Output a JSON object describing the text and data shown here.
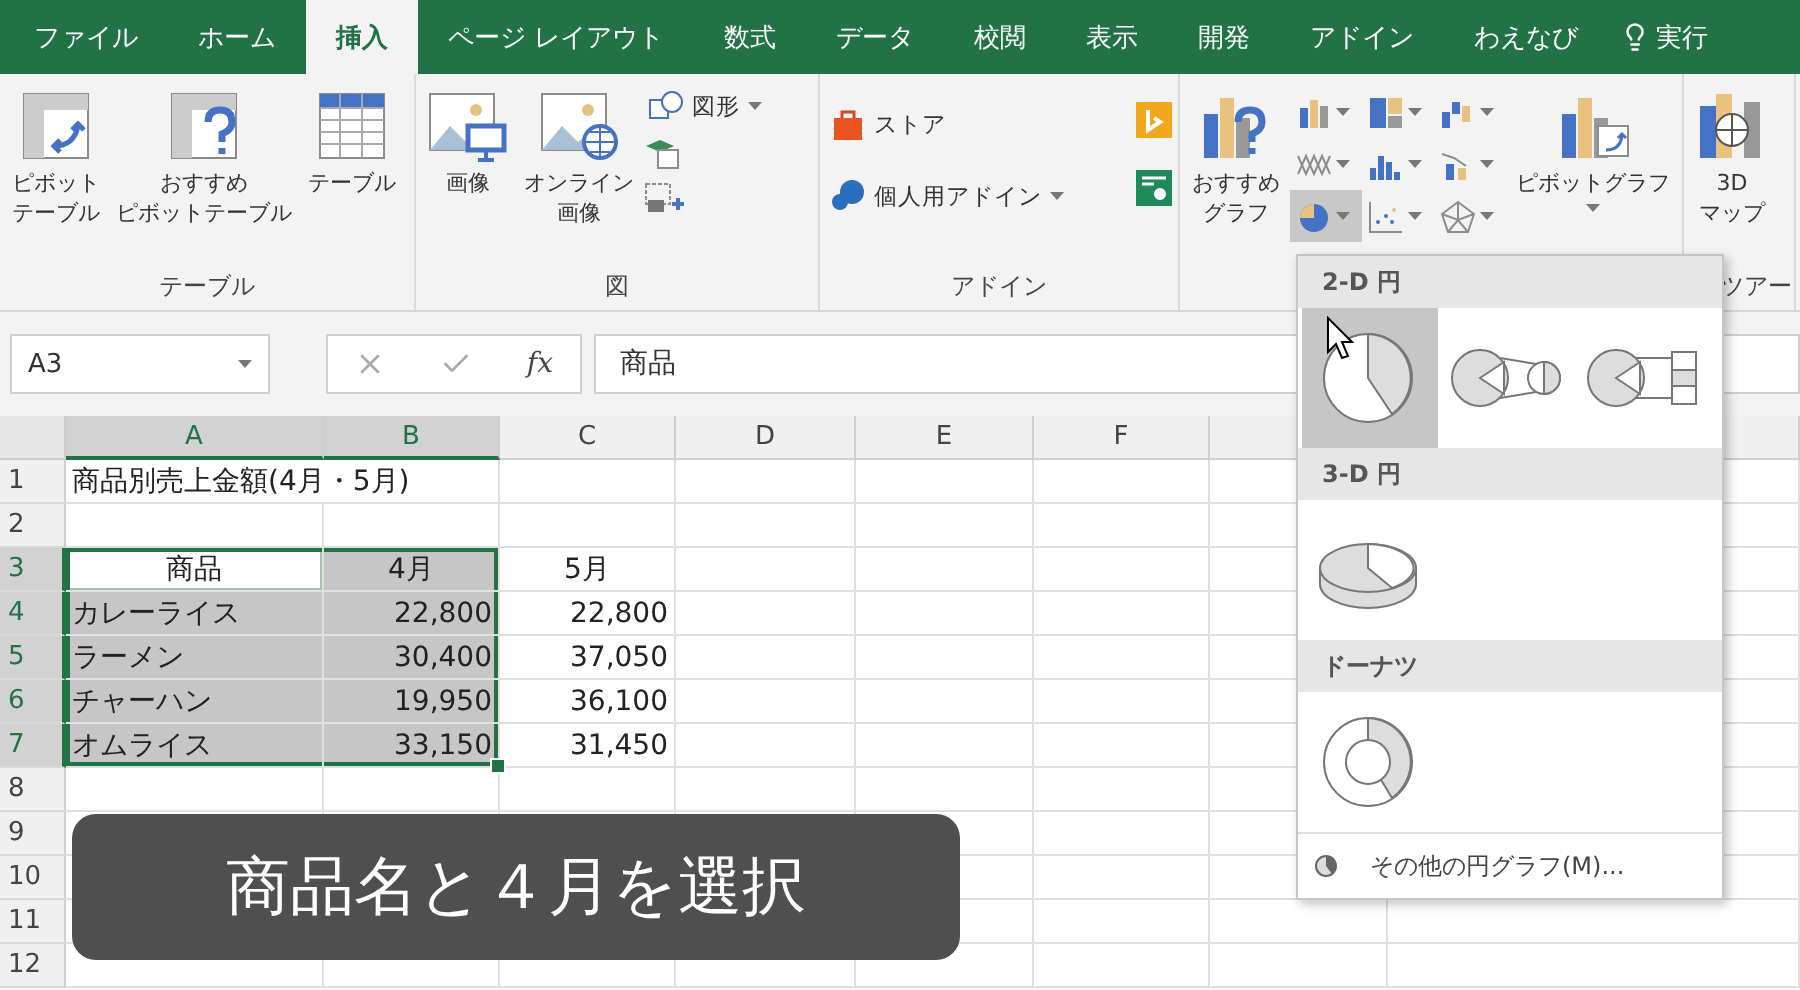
{
  "tabs": [
    {
      "label": "ファイル",
      "selected": false
    },
    {
      "label": "ホーム",
      "selected": false
    },
    {
      "label": "挿入",
      "selected": true
    },
    {
      "label": "ページ レイアウト",
      "selected": false
    },
    {
      "label": "数式",
      "selected": false
    },
    {
      "label": "データ",
      "selected": false
    },
    {
      "label": "校閲",
      "selected": false
    },
    {
      "label": "表示",
      "selected": false
    },
    {
      "label": "開発",
      "selected": false
    },
    {
      "label": "アドイン",
      "selected": false
    },
    {
      "label": "わえなび",
      "selected": false
    }
  ],
  "tell_me": "実行",
  "ribbon": {
    "table_group": {
      "label": "テーブル",
      "buttons": [
        [
          "ピボット",
          "テーブル"
        ],
        [
          "おすすめ",
          "ピボットテーブル"
        ],
        [
          "テーブル"
        ]
      ]
    },
    "illustrations_group": {
      "label": "図",
      "buttons": [
        [
          "画像"
        ],
        [
          "オンライン",
          "画像"
        ]
      ],
      "shapes": "図形"
    },
    "addins_group": {
      "label": "アドイン",
      "store": "ストア",
      "my_addins": "個人用アドイン"
    },
    "chart_group": {
      "recommended": [
        "おすすめ",
        "グラフ"
      ],
      "pivot_chart": "ピボットグラフ",
      "chart_types": [
        {
          "kind": "column",
          "selected": false
        },
        {
          "kind": "treemap",
          "selected": false
        },
        {
          "kind": "waterfall",
          "selected": false
        },
        {
          "kind": "line",
          "selected": false
        },
        {
          "kind": "histogram",
          "selected": false
        },
        {
          "kind": "combo",
          "selected": false
        },
        {
          "kind": "pie",
          "selected": true
        },
        {
          "kind": "scatter",
          "selected": false
        },
        {
          "kind": "radar",
          "selected": false
        }
      ]
    },
    "tours_group": {
      "label": "ツアー",
      "button": [
        "3D",
        "マップ"
      ]
    }
  },
  "name_box": {
    "value": "A3"
  },
  "fx_label": "fx",
  "formula": {
    "value": "商品"
  },
  "columns": [
    {
      "label": "A",
      "selected": true
    },
    {
      "label": "B",
      "selected": true
    },
    {
      "label": "C",
      "selected": false
    },
    {
      "label": "D",
      "selected": false
    },
    {
      "label": "E",
      "selected": false
    },
    {
      "label": "F",
      "selected": false
    }
  ],
  "rows": [
    {
      "label": "1",
      "selected": false,
      "cells": [
        {
          "text": "商品別売上金額(4月・5月)",
          "kind": "title",
          "selected": false,
          "active": false
        }
      ]
    },
    {
      "label": "2",
      "selected": false,
      "cells": []
    },
    {
      "label": "3",
      "selected": true,
      "cells": [
        {
          "text": "商品",
          "kind": "header",
          "selected": true,
          "active": true
        },
        {
          "text": "4月",
          "kind": "header",
          "selected": true,
          "active": false
        },
        {
          "text": "5月",
          "kind": "header",
          "selected": false,
          "active": false
        }
      ]
    },
    {
      "label": "4",
      "selected": true,
      "cells": [
        {
          "text": "カレーライス",
          "kind": "text",
          "selected": true,
          "active": false
        },
        {
          "text": "22,800",
          "kind": "number",
          "selected": true,
          "active": false
        },
        {
          "text": "22,800",
          "kind": "number",
          "selected": false,
          "active": false
        }
      ]
    },
    {
      "label": "5",
      "selected": true,
      "cells": [
        {
          "text": "ラーメン",
          "kind": "text",
          "selected": true,
          "active": false
        },
        {
          "text": "30,400",
          "kind": "number",
          "selected": true,
          "active": false
        },
        {
          "text": "37,050",
          "kind": "number",
          "selected": false,
          "active": false
        }
      ]
    },
    {
      "label": "6",
      "selected": true,
      "cells": [
        {
          "text": "チャーハン",
          "kind": "text",
          "selected": true,
          "active": false
        },
        {
          "text": "19,950",
          "kind": "number",
          "selected": true,
          "active": false
        },
        {
          "text": "36,100",
          "kind": "number",
          "selected": false,
          "active": false
        }
      ]
    },
    {
      "label": "7",
      "selected": true,
      "cells": [
        {
          "text": "オムライス",
          "kind": "text",
          "selected": true,
          "active": false
        },
        {
          "text": "33,150",
          "kind": "number",
          "selected": true,
          "active": false
        },
        {
          "text": "31,450",
          "kind": "number",
          "selected": false,
          "active": false
        }
      ]
    },
    {
      "label": "8",
      "selected": false,
      "cells": []
    },
    {
      "label": "9",
      "selected": false,
      "cells": []
    },
    {
      "label": "10",
      "selected": false,
      "cells": []
    },
    {
      "label": "11",
      "selected": false,
      "cells": []
    },
    {
      "label": "12",
      "selected": false,
      "cells": []
    }
  ],
  "pie_menu": {
    "sections": [
      {
        "title": "2-D 円",
        "items": [
          {
            "kind": "pie",
            "selected": true
          },
          {
            "kind": "pie-of-pie",
            "selected": false
          },
          {
            "kind": "bar-of-pie",
            "selected": false
          }
        ]
      },
      {
        "title": "3-D 円",
        "items": [
          {
            "kind": "pie-3d",
            "selected": false
          }
        ]
      },
      {
        "title": "ドーナツ",
        "items": [
          {
            "kind": "doughnut",
            "selected": false
          }
        ]
      }
    ],
    "footer": "その他の円グラフ(M)..."
  },
  "caption": "商品名と４月を選択"
}
